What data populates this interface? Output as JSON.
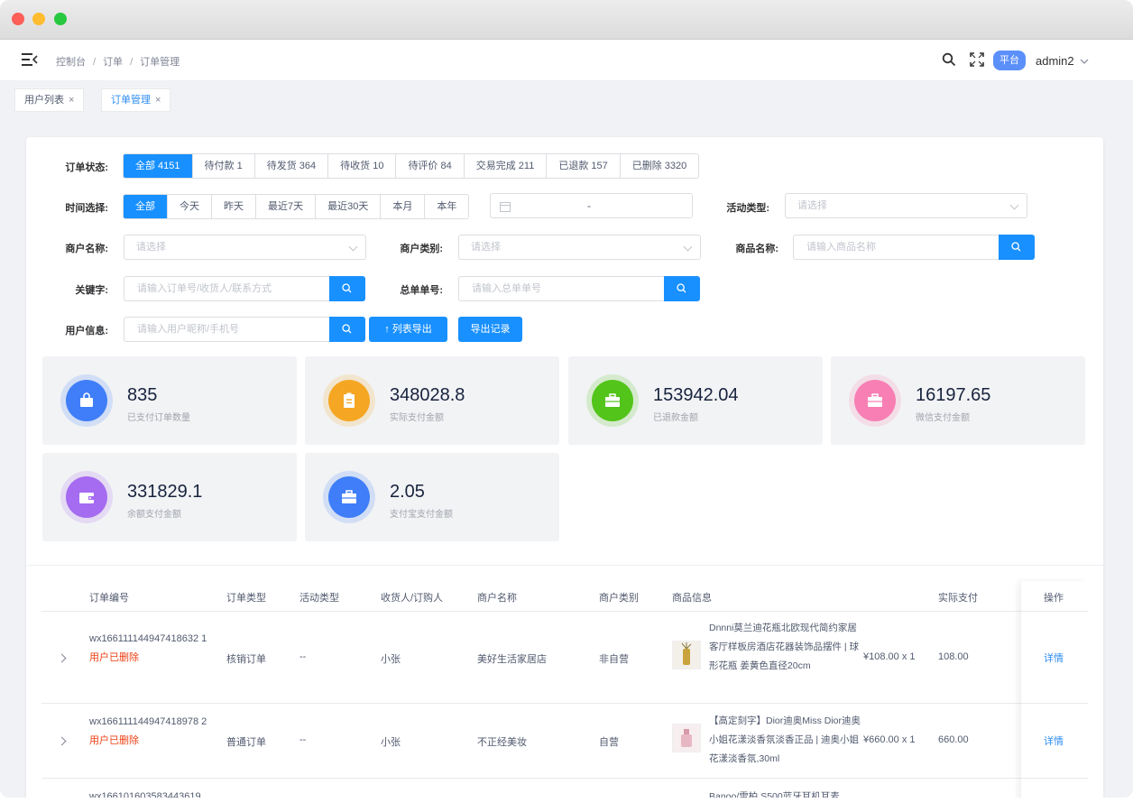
{
  "breadcrumb": [
    "控制台",
    "订单",
    "订单管理"
  ],
  "header": {
    "platform_badge": "平台",
    "user": "admin2"
  },
  "tags": [
    {
      "label": "用户列表",
      "close": "×"
    },
    {
      "label": "订单管理",
      "close": "×"
    }
  ],
  "filters": {
    "order_status_label": "订单状态:",
    "order_status": [
      "全部 4151",
      "待付款 1",
      "待发货 364",
      "待收货 10",
      "待评价 84",
      "交易完成 211",
      "已退款 157",
      "已删除 3320"
    ],
    "time_label": "时间选择:",
    "time_options": [
      "全部",
      "今天",
      "昨天",
      "最近7天",
      "最近30天",
      "本月",
      "本年"
    ],
    "date_sep": "-",
    "activity_label": "活动类型:",
    "activity_placeholder": "请选择",
    "merchant_name_label": "商户名称:",
    "merchant_name_placeholder": "请选择",
    "merchant_type_label": "商户类别:",
    "merchant_type_placeholder": "请选择",
    "product_name_label": "商品名称:",
    "product_name_placeholder": "请输入商品名称",
    "keyword_label": "关键字:",
    "keyword_placeholder": "请输入订单号/收货人/联系方式",
    "total_no_label": "总单单号:",
    "total_no_placeholder": "请输入总单单号",
    "user_label": "用户信息:",
    "user_placeholder": "请输入用户昵称/手机号",
    "export_list": "列表导出",
    "export_records": "导出记录"
  },
  "stats": [
    {
      "value": "835",
      "label": "已支付订单数量",
      "color": "#3f7ef8"
    },
    {
      "value": "348028.8",
      "label": "实际支付金额",
      "color": "#f5a623"
    },
    {
      "value": "153942.04",
      "label": "已退款金额",
      "color": "#52c41a"
    },
    {
      "value": "16197.65",
      "label": "微信支付金额",
      "color": "#f77fb4"
    },
    {
      "value": "331829.1",
      "label": "余额支付金额",
      "color": "#a56bf0"
    },
    {
      "value": "2.05",
      "label": "支付宝支付金额",
      "color": "#3f7ef8"
    }
  ],
  "table": {
    "columns": [
      "订单编号",
      "订单类型",
      "活动类型",
      "收货人/订购人",
      "商户名称",
      "商户类别",
      "商品信息",
      "实际支付",
      "操作"
    ],
    "rows": [
      {
        "order_no": "wx166111144947418632 1",
        "status": "用户已删除",
        "order_type": "核销订单",
        "activity": "--",
        "receiver": "小张",
        "merchant": "美好生活家居店",
        "merchant_type": "非自营",
        "product": "Dnnni莫兰迪花瓶北欧现代简约家居客厅样板房酒店花器装饰品摆件 | 球形花瓶 姜黄色直径20cm",
        "price": "¥108.00 x 1",
        "paid": "108.00",
        "action": "详情"
      },
      {
        "order_no": "wx166111144947418978 2",
        "status": "用户已删除",
        "order_type": "普通订单",
        "activity": "--",
        "receiver": "小张",
        "merchant": "不正经美妆",
        "merchant_type": "自营",
        "product": "【高定刻字】Dior迪奥Miss Dior迪奥小姐花漾淡香氛淡香正品 | 迪奥小姐花漾淡香氛,30ml",
        "price": "¥660.00 x 1",
        "paid": "660.00",
        "action": "详情"
      },
      {
        "order_no": "wx166101603583443619",
        "product": "Banoo/雷柏 S500蓝牙耳机耳麦"
      }
    ]
  }
}
